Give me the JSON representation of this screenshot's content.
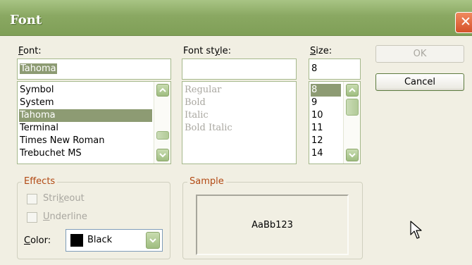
{
  "window": {
    "title": "Font",
    "close_glyph": "✕"
  },
  "font": {
    "label_access_key": "F",
    "label_rest": "ont:",
    "value": "Tahoma",
    "items": [
      "Symbol",
      "System",
      "Tahoma",
      "Terminal",
      "Times New Roman",
      "Trebuchet MS"
    ],
    "selected": "Tahoma"
  },
  "style": {
    "label_before": "Font st",
    "label_access_key": "y",
    "label_after": "le:",
    "value": "",
    "items": [
      "Regular",
      "Bold",
      "Italic",
      "Bold Italic"
    ]
  },
  "size": {
    "label_access_key": "S",
    "label_rest": "ize:",
    "value": "8",
    "items": [
      "8",
      "9",
      "10",
      "11",
      "12",
      "14"
    ],
    "selected": "8"
  },
  "buttons": {
    "ok": "OK",
    "cancel": "Cancel"
  },
  "effects": {
    "title": "Effects",
    "strikeout_before": "Stri",
    "strikeout_key": "k",
    "strikeout_after": "eout",
    "underline_key": "U",
    "underline_rest": "nderline",
    "color_key": "C",
    "color_rest": "olor:",
    "color_value": "Black",
    "color_hex": "#000000"
  },
  "sample": {
    "title": "Sample",
    "text": "AaBb123"
  },
  "colors": {
    "titlebar": "#8aa862",
    "selection": "#8d9b73",
    "group_label": "#b24a14",
    "close": "#d5512a"
  },
  "icons": [
    "close-icon",
    "scroll-up-icon",
    "scroll-down-icon",
    "dropdown-arrow-icon",
    "mouse-cursor-icon"
  ]
}
